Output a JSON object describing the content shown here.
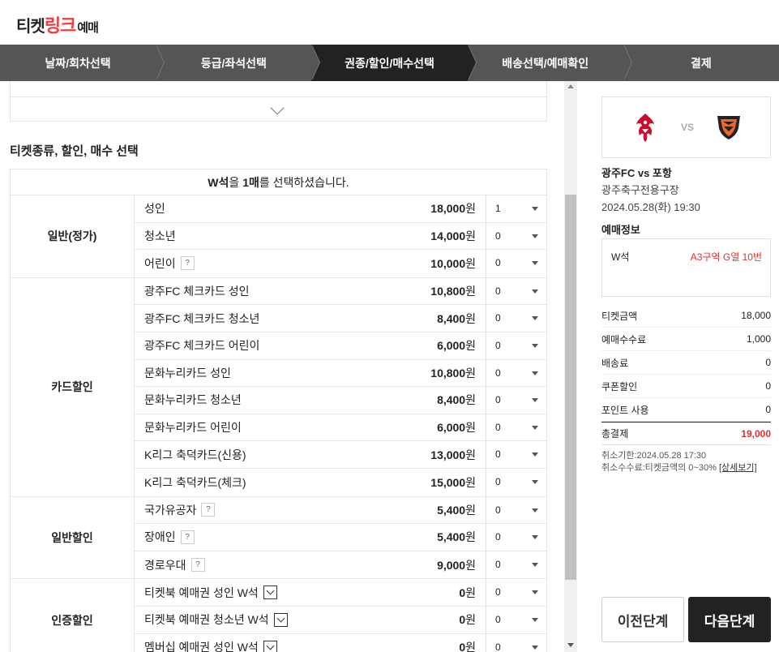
{
  "header": {
    "logo_part1": "티켓",
    "logo_part2": "링크",
    "logo_part3": "예매"
  },
  "steps": [
    "날짜/회차선택",
    "등급/좌석선택",
    "권종/할인/매수선택",
    "배송선택/예매확인",
    "결제"
  ],
  "active_step": 2,
  "section_title": "티켓종류, 할인, 매수 선택",
  "notice": {
    "seat": "W석",
    "mid": "을 ",
    "count": "1매",
    "tail": "를 선택하셨습니다."
  },
  "groups": [
    {
      "name": "일반(정가)",
      "rows": [
        {
          "label": "성인",
          "price": "18,000",
          "unit": "원",
          "qty": "1",
          "help": false,
          "dropdown": false
        },
        {
          "label": "청소년",
          "price": "14,000",
          "unit": "원",
          "qty": "0",
          "help": false,
          "dropdown": false
        },
        {
          "label": "어린이",
          "price": "10,000",
          "unit": "원",
          "qty": "0",
          "help": true,
          "dropdown": false
        }
      ]
    },
    {
      "name": "카드할인",
      "rows": [
        {
          "label": "광주FC 체크카드 성인",
          "price": "10,800",
          "unit": "원",
          "qty": "0",
          "help": false,
          "dropdown": false
        },
        {
          "label": "광주FC 체크카드 청소년",
          "price": "8,400",
          "unit": "원",
          "qty": "0",
          "help": false,
          "dropdown": false
        },
        {
          "label": "광주FC 체크카드 어린이",
          "price": "6,000",
          "unit": "원",
          "qty": "0",
          "help": false,
          "dropdown": false
        },
        {
          "label": "문화누리카드 성인",
          "price": "10,800",
          "unit": "원",
          "qty": "0",
          "help": false,
          "dropdown": false
        },
        {
          "label": "문화누리카드 청소년",
          "price": "8,400",
          "unit": "원",
          "qty": "0",
          "help": false,
          "dropdown": false
        },
        {
          "label": "문화누리카드 어린이",
          "price": "6,000",
          "unit": "원",
          "qty": "0",
          "help": false,
          "dropdown": false
        },
        {
          "label": "K리그 축덕카드(신용)",
          "price": "13,000",
          "unit": "원",
          "qty": "0",
          "help": false,
          "dropdown": false
        },
        {
          "label": "K리그 축덕카드(체크)",
          "price": "15,000",
          "unit": "원",
          "qty": "0",
          "help": false,
          "dropdown": false
        }
      ]
    },
    {
      "name": "일반할인",
      "rows": [
        {
          "label": "국가유공자",
          "price": "5,400",
          "unit": "원",
          "qty": "0",
          "help": true,
          "dropdown": false
        },
        {
          "label": "장애인",
          "price": "5,400",
          "unit": "원",
          "qty": "0",
          "help": true,
          "dropdown": false
        },
        {
          "label": "경로우대",
          "price": "9,000",
          "unit": "원",
          "qty": "0",
          "help": true,
          "dropdown": false
        }
      ]
    },
    {
      "name": "인증할인",
      "rows": [
        {
          "label": "티켓북 예매권 성인 W석",
          "price": "0",
          "unit": "원",
          "qty": "0",
          "help": false,
          "dropdown": true
        },
        {
          "label": "티켓북 예매권 청소년 W석",
          "price": "0",
          "unit": "원",
          "qty": "0",
          "help": false,
          "dropdown": true
        },
        {
          "label": "멤버십 예매권 성인 W석",
          "price": "0",
          "unit": "원",
          "qty": "0",
          "help": false,
          "dropdown": true
        }
      ]
    }
  ],
  "help_glyph": "?",
  "match": {
    "vs": "VS",
    "title": "광주FC vs 포항",
    "venue": "광주축구전용구장",
    "date": "2024.05.28(화) 19:30"
  },
  "booking": {
    "title": "예매정보",
    "grade": "W석",
    "location": "A3구역 G열 10번"
  },
  "summary": [
    {
      "label": "티켓금액",
      "value": "18,000"
    },
    {
      "label": "예매수수료",
      "value": "1,000"
    },
    {
      "label": "배송료",
      "value": "0"
    },
    {
      "label": "쿠폰할인",
      "value": "0"
    },
    {
      "label": "포인트 사용",
      "value": "0"
    }
  ],
  "total": {
    "label": "총결제",
    "value": "19,000"
  },
  "notes": {
    "cancel_deadline": "취소기한:2024.05.28 17:30",
    "cancel_fee": "취소수수료:티켓금액의 0~30% ",
    "detail_link": "[상세보기]"
  },
  "buttons": {
    "prev": "이전단계",
    "next": "다음단계"
  },
  "colors": {
    "accent": "#ef3e42",
    "step_bg": "#555555",
    "step_active": "#222222",
    "price_red": "#e03030"
  }
}
